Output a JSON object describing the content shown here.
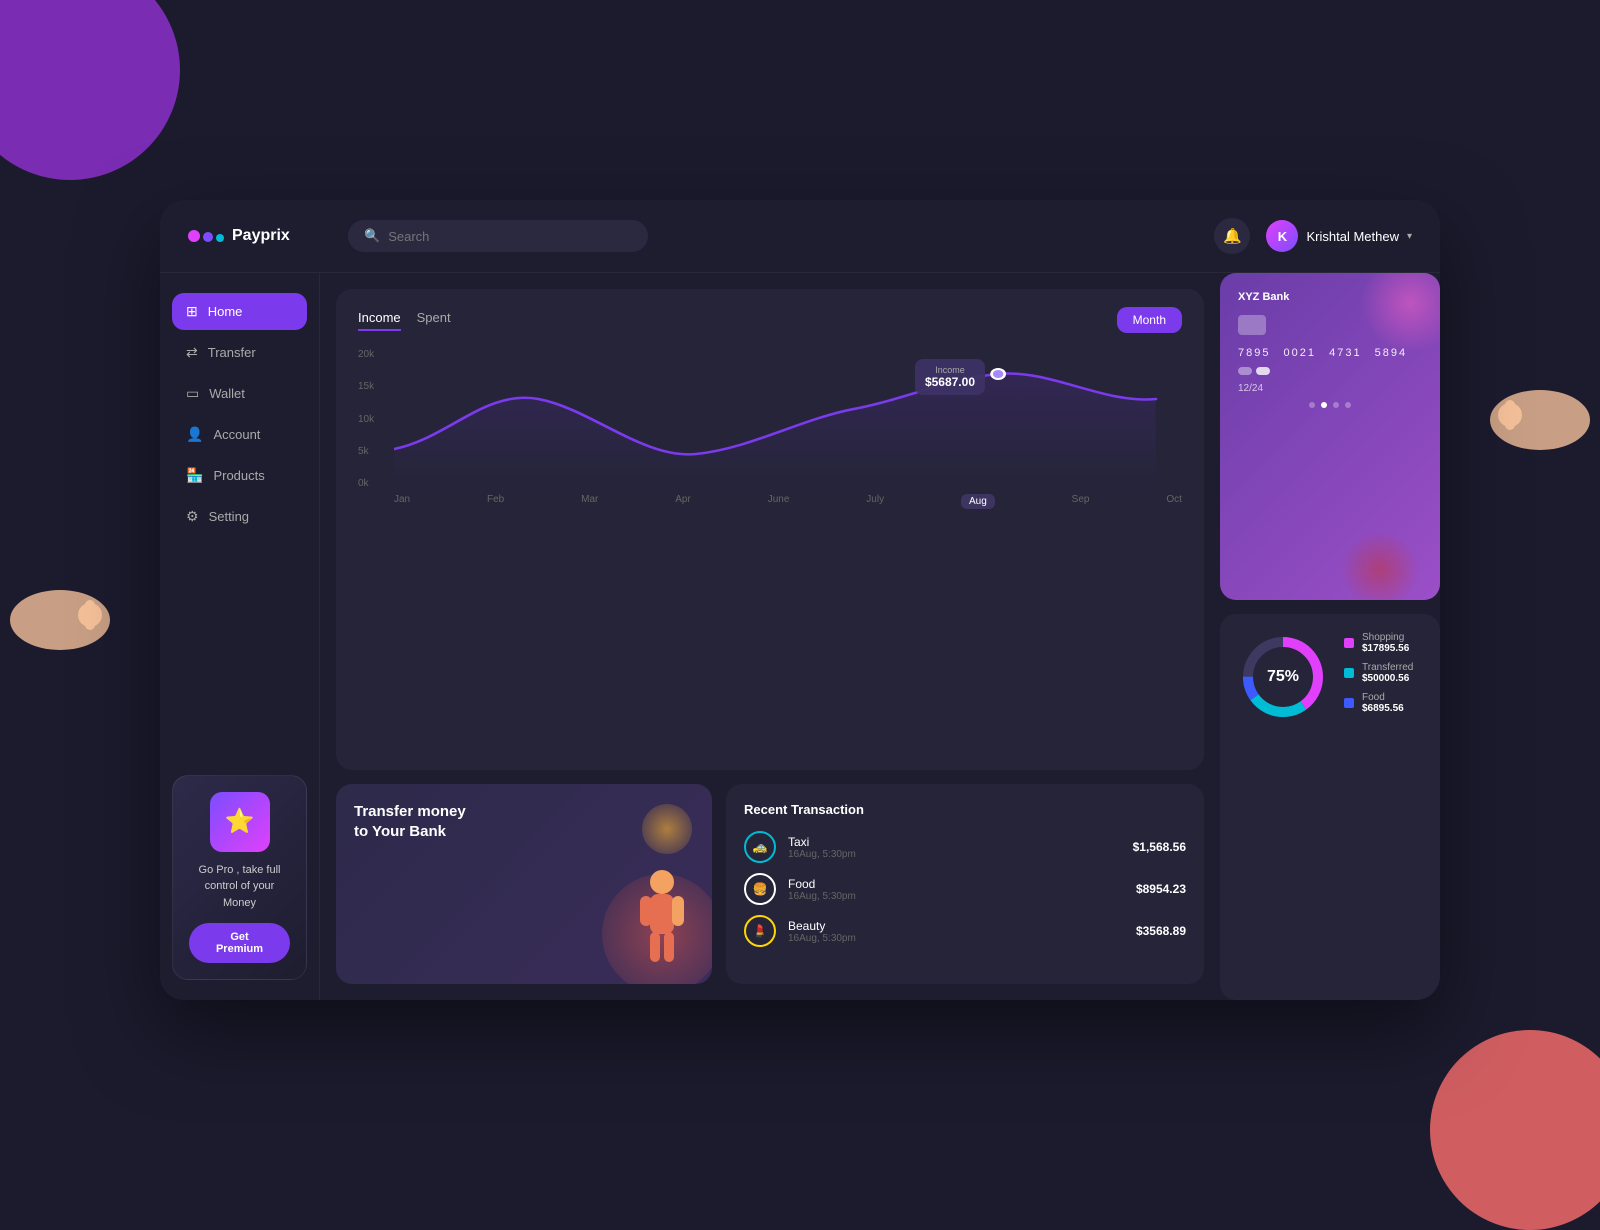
{
  "app": {
    "name": "Payprix",
    "bg_color": "#1c1b2e"
  },
  "topbar": {
    "search_placeholder": "Search",
    "user_name": "Krishtal Methew",
    "bell_icon": "🔔"
  },
  "sidebar": {
    "items": [
      {
        "id": "home",
        "label": "Home",
        "icon": "⊞",
        "active": true
      },
      {
        "id": "transfer",
        "label": "Transfer",
        "icon": "⇄",
        "active": false
      },
      {
        "id": "wallet",
        "label": "Wallet",
        "icon": "▭",
        "active": false
      },
      {
        "id": "account",
        "label": "Account",
        "icon": "👤",
        "active": false
      },
      {
        "id": "products",
        "label": "Products",
        "icon": "🏪",
        "active": false
      },
      {
        "id": "setting",
        "label": "Setting",
        "icon": "⚙",
        "active": false
      }
    ],
    "pro_card": {
      "text": "Go Pro , take full control of your Money",
      "button_label": "Get Premium"
    }
  },
  "chart": {
    "tabs": [
      {
        "label": "Income",
        "active": true
      },
      {
        "label": "Spent",
        "active": false
      }
    ],
    "month_button": "Month",
    "y_labels": [
      "20k",
      "15k",
      "10k",
      "5k",
      "0k"
    ],
    "x_labels": [
      "Jan",
      "Feb",
      "Mar",
      "Apr",
      "June",
      "July",
      "Aug",
      "Sep",
      "Oct"
    ],
    "active_month": "Aug",
    "tooltip": {
      "label": "Income",
      "value": "$5687.00"
    }
  },
  "transfer_card": {
    "title": "Transfer money\nto Your Bank"
  },
  "transactions": {
    "title": "Recent Transaction",
    "items": [
      {
        "name": "Taxi",
        "date": "16Aug, 5:30pm",
        "amount": "$1,568.56",
        "icon_type": "taxi"
      },
      {
        "name": "Food",
        "date": "16Aug, 5:30pm",
        "amount": "$8954.23",
        "icon_type": "food"
      },
      {
        "name": "Beauty",
        "date": "16Aug, 5:30pm",
        "amount": "$3568.89",
        "icon_type": "beauty"
      }
    ]
  },
  "bank_card": {
    "bank_name": "XYZ Bank",
    "number_1": "7895",
    "number_2": "0021",
    "number_3": "4731",
    "number_4": "5894",
    "expiry": "12/24"
  },
  "donut": {
    "percentage": "75%",
    "legend": [
      {
        "name": "Shopping",
        "value": "$17895.56",
        "color": "#e040fb"
      },
      {
        "name": "Transferred",
        "value": "$50000.56",
        "color": "#00bcd4"
      },
      {
        "name": "Food",
        "value": "$6895.56",
        "color": "#3d5afe"
      }
    ]
  }
}
